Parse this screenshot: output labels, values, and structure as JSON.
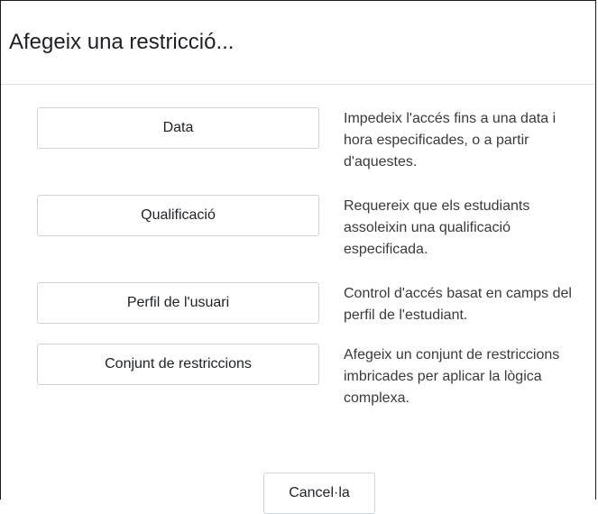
{
  "dialog": {
    "title": "Afegeix una restricció..."
  },
  "options": [
    {
      "button_label": "Data",
      "description": "Impedeix l'accés fins a una data i hora especificades, o a partir d'aquestes."
    },
    {
      "button_label": "Qualificació",
      "description": "Requereix que els estudiants assoleixin una qualificació especificada."
    },
    {
      "button_label": "Perfil de l'usuari",
      "description": "Control d'accés basat en camps del perfil de l'estudiant."
    },
    {
      "button_label": "Conjunt de restriccions",
      "description": "Afegeix un conjunt de restriccions imbricades per aplicar la lògica complexa."
    }
  ],
  "footer": {
    "cancel_label": "Cancel·la"
  }
}
